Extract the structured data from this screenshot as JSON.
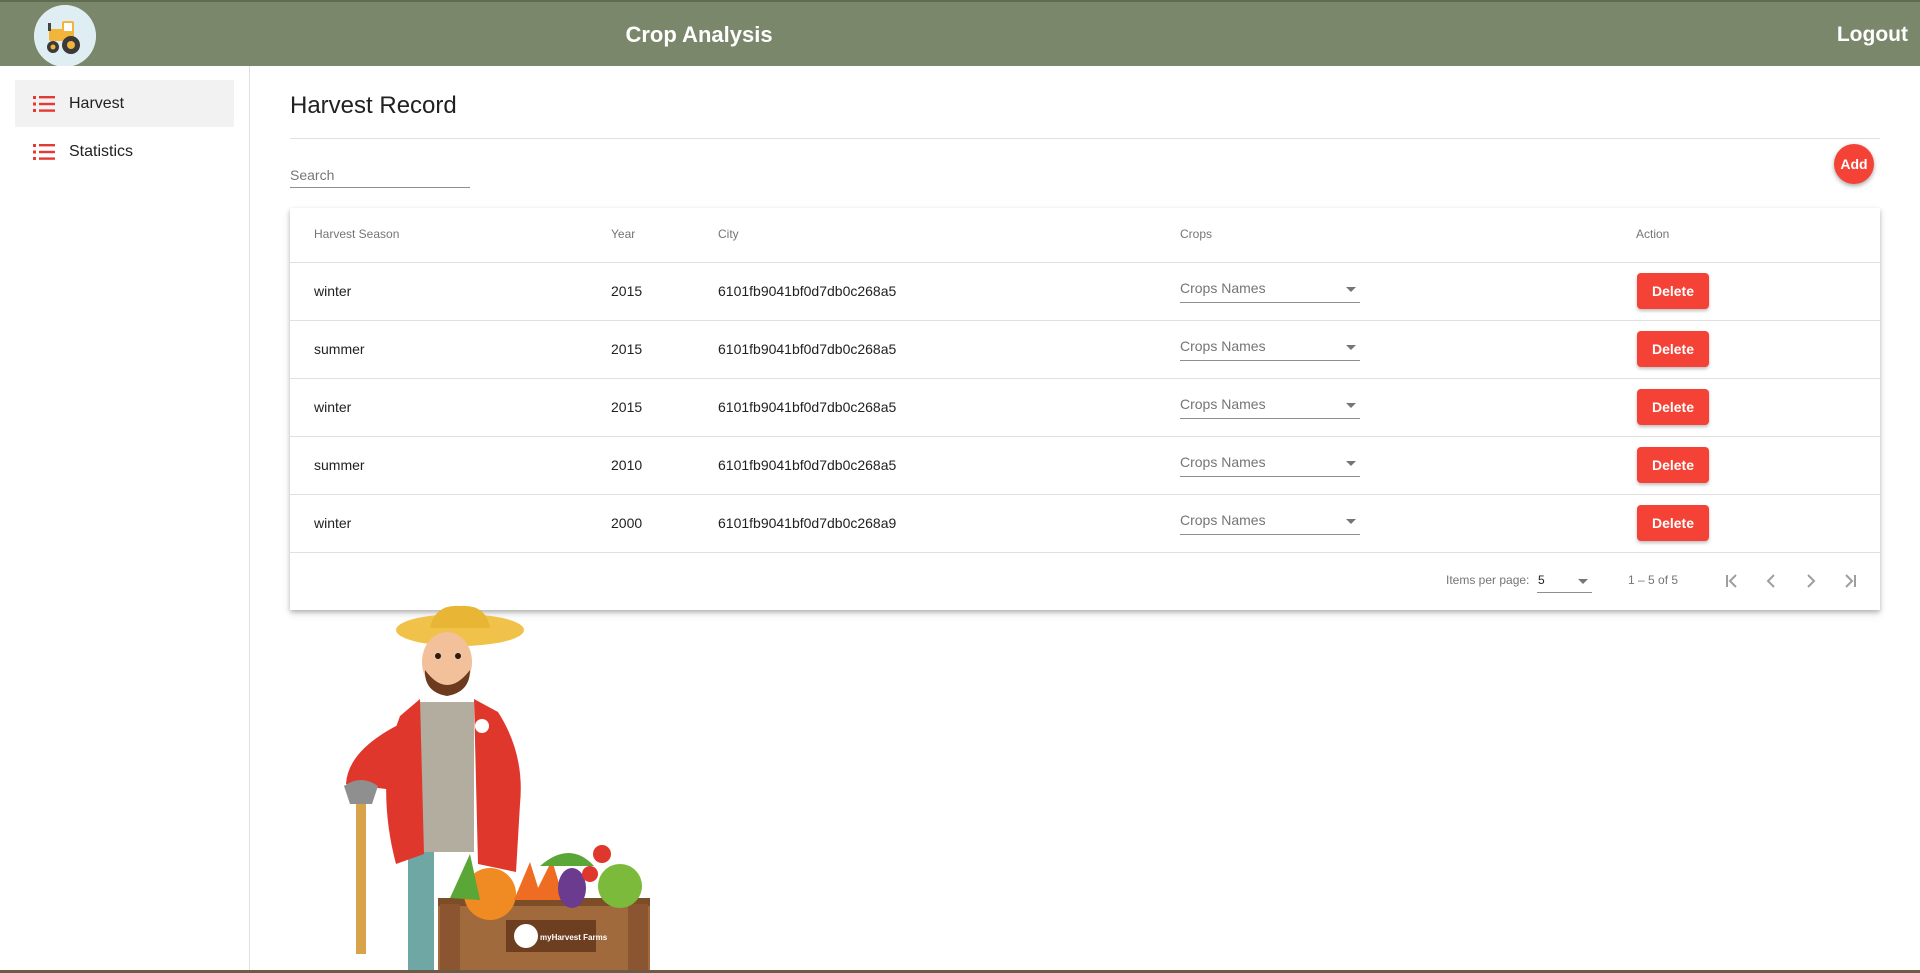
{
  "header": {
    "title": "Crop Analysis",
    "logout_label": "Logout"
  },
  "sidebar": {
    "items": [
      {
        "label": "Harvest",
        "icon": "list-icon",
        "active": true
      },
      {
        "label": "Statistics",
        "icon": "list-icon",
        "active": false
      }
    ]
  },
  "main": {
    "title": "Harvest Record",
    "search": {
      "placeholder": "Search",
      "value": ""
    },
    "add_label": "Add"
  },
  "table": {
    "columns": [
      "Harvest Season",
      "Year",
      "City",
      "Crops",
      "Action"
    ],
    "rows": [
      {
        "season": "winter",
        "year": "2015",
        "city": "6101fb9041bf0d7db0c268a5",
        "crops_placeholder": "Crops Names",
        "action_label": "Delete"
      },
      {
        "season": "summer",
        "year": "2015",
        "city": "6101fb9041bf0d7db0c268a5",
        "crops_placeholder": "Crops Names",
        "action_label": "Delete"
      },
      {
        "season": "winter",
        "year": "2015",
        "city": "6101fb9041bf0d7db0c268a5",
        "crops_placeholder": "Crops Names",
        "action_label": "Delete"
      },
      {
        "season": "summer",
        "year": "2010",
        "city": "6101fb9041bf0d7db0c268a5",
        "crops_placeholder": "Crops Names",
        "action_label": "Delete"
      },
      {
        "season": "winter",
        "year": "2000",
        "city": "6101fb9041bf0d7db0c268a9",
        "crops_placeholder": "Crops Names",
        "action_label": "Delete"
      }
    ]
  },
  "paginator": {
    "items_per_page_label": "Items per page:",
    "page_size": "5",
    "range_label": "1 – 5 of 5"
  },
  "illustration": {
    "crate_text": "myHarvest Farms"
  },
  "colors": {
    "header_bg": "#7a876a",
    "accent": "#f44336",
    "icon_red": "#e53935"
  }
}
